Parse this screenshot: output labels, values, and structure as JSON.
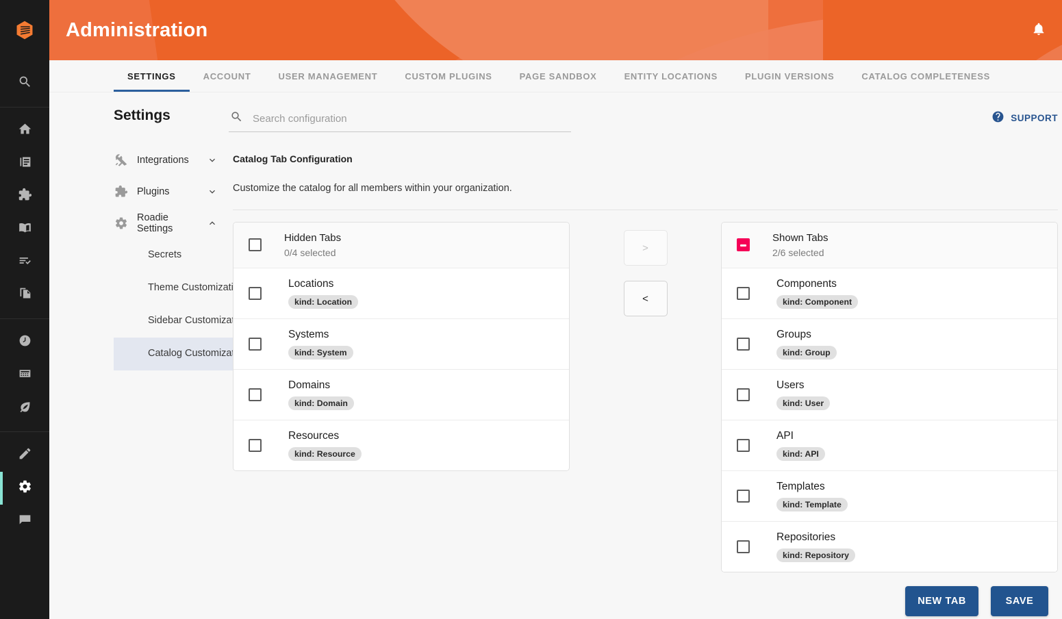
{
  "brand": {
    "logo_icon": "roadie-hex-logo",
    "accent_orange": "#ee6f3d",
    "accent_blue": "#22548f",
    "accent_pink": "#f50057",
    "rail_active_indicator": "#89e3d4"
  },
  "header": {
    "title": "Administration",
    "bell_icon": "notification-bell-icon"
  },
  "rail": {
    "groups": [
      {
        "items": [
          {
            "icon": "search-icon",
            "name": "search"
          }
        ]
      },
      {
        "items": [
          {
            "icon": "home-icon",
            "name": "home"
          },
          {
            "icon": "catalog-icon",
            "name": "catalog"
          },
          {
            "icon": "puzzle-icon",
            "name": "plugins"
          },
          {
            "icon": "book-icon",
            "name": "docs"
          },
          {
            "icon": "checklist-icon",
            "name": "tasks"
          },
          {
            "icon": "copy-files-icon",
            "name": "templates"
          }
        ]
      },
      {
        "items": [
          {
            "icon": "clock-icon",
            "name": "recent"
          },
          {
            "icon": "calculator-icon",
            "name": "tools"
          },
          {
            "icon": "leaf-icon",
            "name": "environment"
          }
        ]
      },
      {
        "items": [
          {
            "icon": "pencil-icon",
            "name": "create"
          },
          {
            "icon": "gear-icon",
            "name": "administration",
            "active": true
          },
          {
            "icon": "chat-icon",
            "name": "feedback"
          }
        ]
      }
    ]
  },
  "tabs": [
    {
      "label": "SETTINGS",
      "active": true
    },
    {
      "label": "ACCOUNT",
      "active": false
    },
    {
      "label": "USER MANAGEMENT",
      "active": false
    },
    {
      "label": "CUSTOM PLUGINS",
      "active": false
    },
    {
      "label": "PAGE SANDBOX",
      "active": false
    },
    {
      "label": "ENTITY LOCATIONS",
      "active": false
    },
    {
      "label": "PLUGIN VERSIONS",
      "active": false
    },
    {
      "label": "CATALOG COMPLETENESS",
      "active": false
    }
  ],
  "page": {
    "title": "Settings"
  },
  "leftnav": {
    "groups": [
      {
        "label": "Integrations",
        "icon": "tools-icon",
        "chevron": "chevron-down-icon",
        "expanded": false
      },
      {
        "label": "Plugins",
        "icon": "puzzle-icon",
        "chevron": "chevron-down-icon",
        "expanded": false
      },
      {
        "label": "Roadie Settings",
        "icon": "gear-icon",
        "chevron": "chevron-up-icon",
        "expanded": true
      }
    ],
    "subitems": [
      {
        "label": "Secrets",
        "active": false
      },
      {
        "label": "Theme Customization",
        "active": false
      },
      {
        "label": "Sidebar Customization",
        "active": false
      },
      {
        "label": "Catalog Customization",
        "active": true
      }
    ]
  },
  "search": {
    "placeholder": "Search configuration",
    "value": "",
    "icon": "search-icon"
  },
  "support": {
    "label": "SUPPORT",
    "icon": "help-circle-icon"
  },
  "section": {
    "title": "Catalog Tab Configuration",
    "description": "Customize the catalog for all members within your organization."
  },
  "hidden_panel": {
    "title": "Hidden Tabs",
    "subtitle": "0/4 selected",
    "checkbox_state": "unchecked",
    "rows": [
      {
        "name": "Locations",
        "chip": "kind: Location",
        "checked": false
      },
      {
        "name": "Systems",
        "chip": "kind: System",
        "checked": false
      },
      {
        "name": "Domains",
        "chip": "kind: Domain",
        "checked": false
      },
      {
        "name": "Resources",
        "chip": "kind: Resource",
        "checked": false
      }
    ]
  },
  "shown_panel": {
    "title": "Shown Tabs",
    "subtitle": "2/6 selected",
    "checkbox_state": "indeterminate",
    "rows": [
      {
        "name": "Components",
        "chip": "kind: Component",
        "checked": false
      },
      {
        "name": "Groups",
        "chip": "kind: Group",
        "checked": false
      },
      {
        "name": "Users",
        "chip": "kind: User",
        "checked": false
      },
      {
        "name": "API",
        "chip": "kind: API",
        "checked": false
      },
      {
        "name": "Templates",
        "chip": "kind: Template",
        "checked": false
      },
      {
        "name": "Repositories",
        "chip": "kind: Repository",
        "checked": false
      }
    ]
  },
  "transfer_buttons": {
    "move_right": ">",
    "move_left": "<",
    "move_right_disabled": true,
    "move_left_disabled": false
  },
  "footer": {
    "new_tab_label": "NEW TAB",
    "save_label": "SAVE"
  }
}
